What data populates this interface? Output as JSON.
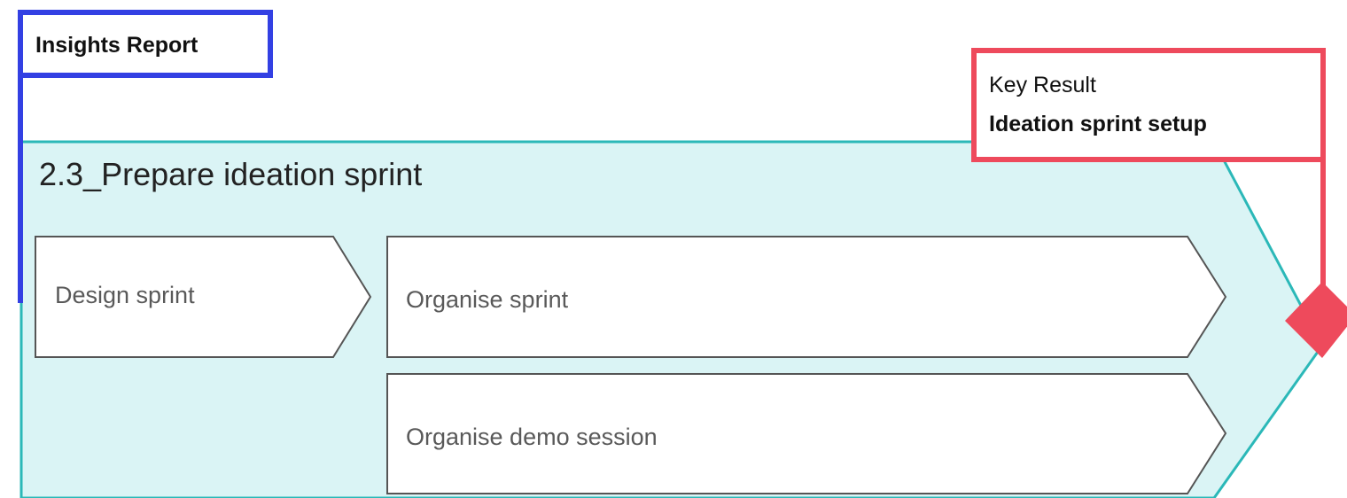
{
  "phase": {
    "title": "2.3_Prepare ideation sprint"
  },
  "steps": [
    {
      "label": "Design sprint"
    },
    {
      "label": "Organise sprint"
    },
    {
      "label": "Organise demo session"
    }
  ],
  "insights_report": {
    "label": "Insights Report"
  },
  "key_result": {
    "caption": "Key Result",
    "title": "Ideation sprint setup"
  },
  "colors": {
    "phase_fill": "#daf4f5",
    "phase_border": "#2bb8b8",
    "step_fill": "#ffffff",
    "step_border": "#555555",
    "insights_accent": "#3340e3",
    "key_result_accent": "#ee4a5c"
  }
}
